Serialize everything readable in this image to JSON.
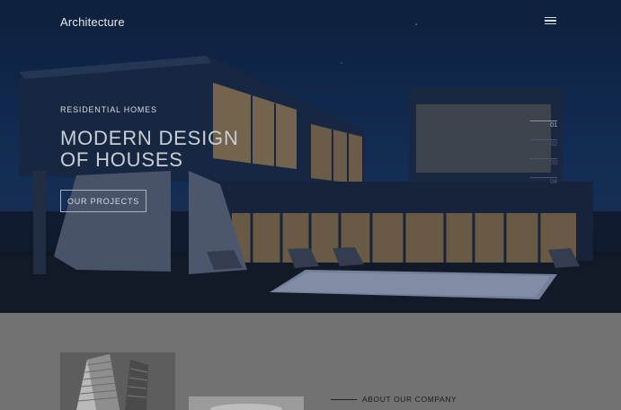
{
  "header": {
    "brand": "Architecture",
    "menu_icon": "hamburger-menu-icon"
  },
  "hero": {
    "eyebrow": "RESIDENTIAL HOMES",
    "title_line1": "MODERN DESIGN",
    "title_line2": "OF HOUSES",
    "cta_label": "OUR PROJECTS",
    "slides": [
      {
        "label": "01",
        "active": true
      },
      {
        "label": "02",
        "active": false
      },
      {
        "label": "03",
        "active": false
      },
      {
        "label": "04",
        "active": false
      }
    ]
  },
  "about": {
    "label": "ABOUT OUR COMPANY"
  },
  "colors": {
    "hero_sky": "#14305a",
    "window_glow": "#c9a46a",
    "section_bg": "#727272"
  }
}
